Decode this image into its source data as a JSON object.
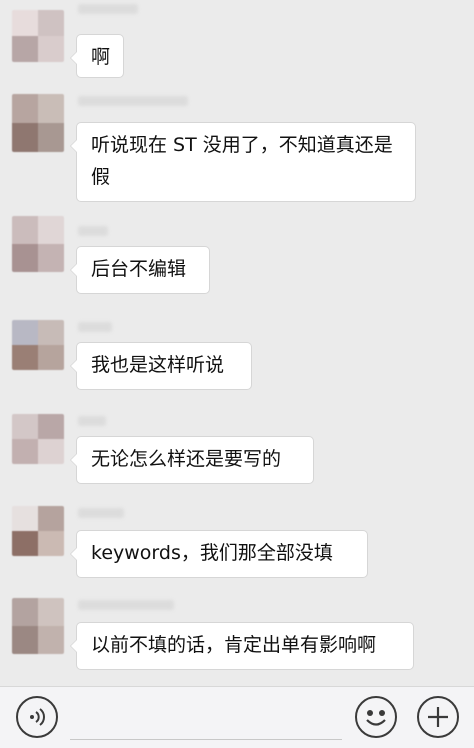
{
  "messages": [
    {
      "text": "啊",
      "avatar_colors": [
        "#e7dcdc",
        "#cfc2c2",
        "#b7a6a6",
        "#d9cccc"
      ]
    },
    {
      "text": "听说现在 ST 没用了，不知道真还是假",
      "avatar_colors": [
        "#b7a5a0",
        "#c9bdb7",
        "#8f7770",
        "#a89892"
      ]
    },
    {
      "text": "后台不编辑",
      "avatar_colors": [
        "#cbbcbc",
        "#e0d6d6",
        "#a89292",
        "#c4b3b3"
      ]
    },
    {
      "text": "我也是这样听说",
      "avatar_colors": [
        "#b8b8c4",
        "#c7bbb7",
        "#9a7f75",
        "#b6a49d"
      ]
    },
    {
      "text": "无论怎么样还是要写的",
      "avatar_colors": [
        "#d3c7c7",
        "#b9a7a7",
        "#c2b0b0",
        "#ddd2d2"
      ]
    },
    {
      "text": "keywords，我们那全部没填",
      "avatar_colors": [
        "#e6e0df",
        "#b5a39e",
        "#8d6f66",
        "#cbbab3"
      ]
    },
    {
      "text": "以前不填的话，肯定出单有影响啊",
      "avatar_colors": [
        "#b3a3a0",
        "#cfc3bf",
        "#9b8883",
        "#c1b2ad"
      ]
    }
  ],
  "toolbar": {
    "voice_icon": "voice-icon",
    "emoji_icon": "emoji-icon",
    "plus_icon": "plus-icon"
  }
}
